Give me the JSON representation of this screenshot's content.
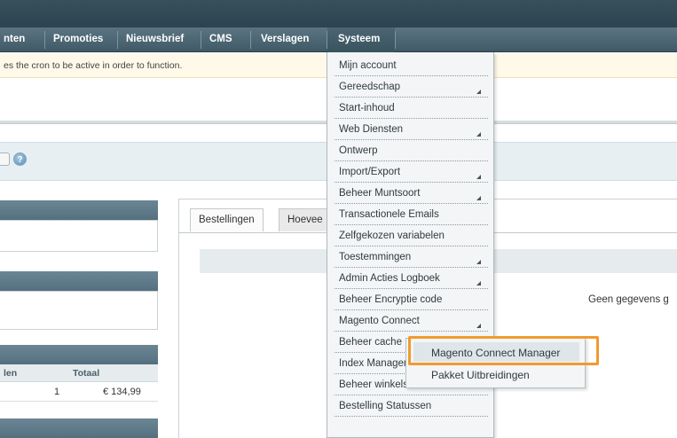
{
  "nav": {
    "items": [
      {
        "label": "nten"
      },
      {
        "label": "Promoties"
      },
      {
        "label": "Nieuwsbrief"
      },
      {
        "label": "CMS"
      },
      {
        "label": "Verslagen"
      },
      {
        "label": "Systeem"
      }
    ]
  },
  "notice": {
    "text": "es the cron to be active in order to function."
  },
  "toolbar": {
    "help_icon": "help-icon",
    "help_glyph": "?"
  },
  "left": {
    "summary_headers": [
      "len",
      "Totaal"
    ],
    "summary_row": {
      "count": "1",
      "total": "€ 134,99"
    }
  },
  "tabs": [
    {
      "label": "Bestellingen"
    },
    {
      "label": "Hoevee"
    }
  ],
  "main": {
    "nodata": "Geen gegevens g"
  },
  "menu": {
    "items": [
      {
        "label": "Mijn account",
        "has_submenu": false
      },
      {
        "label": "Gereedschap",
        "has_submenu": true
      },
      {
        "label": "Start-inhoud",
        "has_submenu": false
      },
      {
        "label": "Web Diensten",
        "has_submenu": true
      },
      {
        "label": "Ontwerp",
        "has_submenu": false
      },
      {
        "label": "Import/Export",
        "has_submenu": true
      },
      {
        "label": "Beheer Muntsoort",
        "has_submenu": true
      },
      {
        "label": "Transactionele Emails",
        "has_submenu": false
      },
      {
        "label": "Zelfgekozen variabelen",
        "has_submenu": false
      },
      {
        "label": "Toestemmingen",
        "has_submenu": true
      },
      {
        "label": "Admin Acties Logboek",
        "has_submenu": true
      },
      {
        "label": "Beheer Encryptie code",
        "has_submenu": false
      },
      {
        "label": "Magento Connect",
        "has_submenu": true
      },
      {
        "label": "Beheer cache",
        "has_submenu": false
      },
      {
        "label": "Index Managem",
        "has_submenu": false
      },
      {
        "label": "Beheer winkels",
        "has_submenu": false
      },
      {
        "label": "Bestelling Statussen",
        "has_submenu": false
      }
    ],
    "submenu": [
      {
        "label": "Magento Connect Manager"
      },
      {
        "label": "Pakket Uitbreidingen"
      }
    ]
  },
  "colors": {
    "nav_bg": "#4a6471",
    "highlight_border": "#f19a2f",
    "notice_bg": "#fff9e9"
  }
}
